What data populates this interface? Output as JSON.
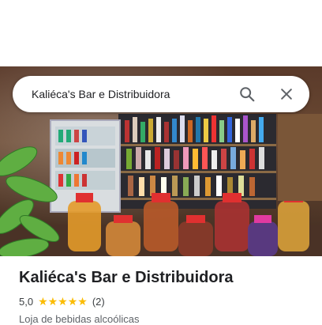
{
  "search": {
    "query": "Kaliéca's Bar e Distribuidora",
    "search_icon": "search-icon",
    "close_icon": "close-icon"
  },
  "hero_photo": {
    "description_icon": "storefront-photo"
  },
  "place": {
    "name": "Kaliéca's Bar e Distribuidora",
    "rating": "5,0",
    "stars": "★★★★★",
    "stars_value": 5,
    "review_count": "(2)",
    "category": "Loja de bebidas alcoólicas"
  },
  "colors": {
    "star": "#fbbc04",
    "text_primary": "#202124",
    "text_secondary": "#5f6368"
  }
}
